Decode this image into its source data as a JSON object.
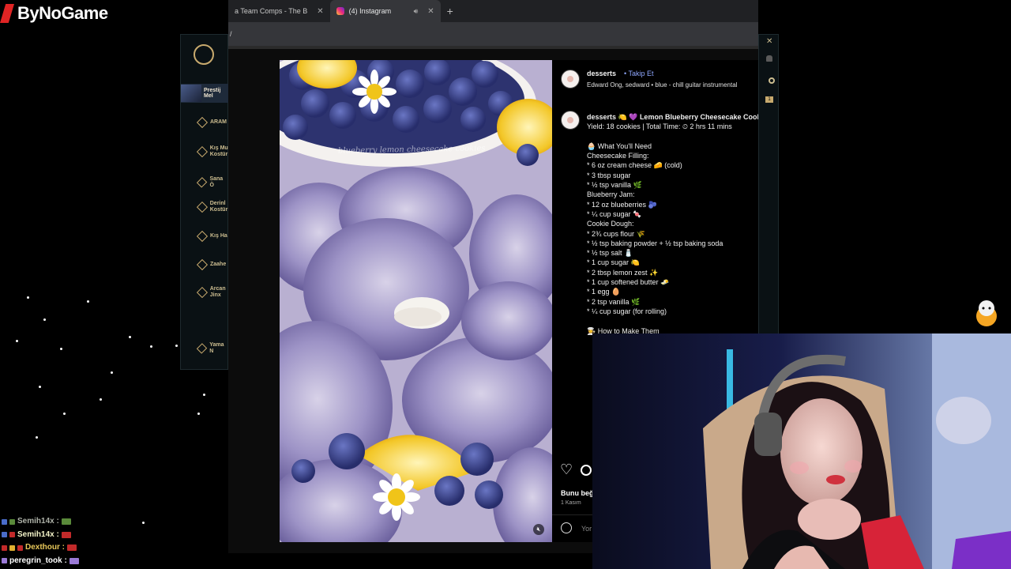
{
  "overlay": {
    "channel_logo_text": "ByNoGame"
  },
  "browser": {
    "tabs": [
      {
        "label": "a Team Comps - The B",
        "active": false
      },
      {
        "label": "(4) Instagram",
        "active": true
      }
    ],
    "address": "/",
    "new_tab_symbol": "+"
  },
  "lol_client": {
    "prestige_label": "Prestij Mel",
    "nav": [
      "ARAM",
      "Kış Mu Kostür",
      "Sana Ö",
      "Derinl Kostür",
      "Kış Ha",
      "Zaahe",
      "Arcan Jinx",
      "Yama N"
    ],
    "badge": "1"
  },
  "post": {
    "image_watermark": "blueberry lemon cheesecake cookies",
    "username": "desserts",
    "follow_label": "Takip Et",
    "music": "Edward Ong, sedward • blue - chill guitar instrumental",
    "caption_lines": [
      "desserts 🍋 💜 Lemon Blueberry Cheesecake Cooki",
      "Yield: 18 cookies | Total Time: ⏲ 2 hrs 11 mins",
      "",
      "🧁 What You'll Need",
      "Cheesecake Filling:",
      "* 6 oz cream cheese 🧀 (cold)",
      "* 3 tbsp sugar",
      "* ½ tsp vanilla 🌿",
      "Blueberry Jam:",
      "* 12 oz blueberries 🫐",
      "* ¼ cup sugar 🍬",
      "Cookie Dough:",
      "* 2¾ cups flour 🌾",
      "* ½ tsp baking powder + ½ tsp baking soda",
      "* ½ tsp salt 🧂",
      "* 1 cup sugar 🍋",
      "* 2 tbsp lemon zest ✨",
      "* 1 cup softened butter 🧈",
      "* 1 egg 🥚",
      "* 2 tsp vanilla 🌿",
      "* ¼ cup sugar (for rolling)",
      "",
      "👩‍🍳 How to Make Them"
    ],
    "likes_text": "Bunu beğ",
    "date_text": "1 Kasım",
    "comment_placeholder": "Yor"
  },
  "chat": [
    {
      "user": "Semih14x :",
      "badges": [
        "#4a6cc9",
        "#5a8a3a"
      ]
    },
    {
      "user": "Semih14x :",
      "badges": [
        "#4a6cc9",
        "#c22a2a"
      ]
    },
    {
      "user": "Dexthour :",
      "badges": [
        "#c22a2a",
        "#e0b030",
        "#c22a2a"
      ]
    },
    {
      "user": "peregrin_took :",
      "badges": [
        "#9a7ad6"
      ]
    }
  ],
  "colors": {
    "instagram_link": "#8fa7ff",
    "lol_gold": "#c8aa6e",
    "logo_red": "#e02424"
  }
}
